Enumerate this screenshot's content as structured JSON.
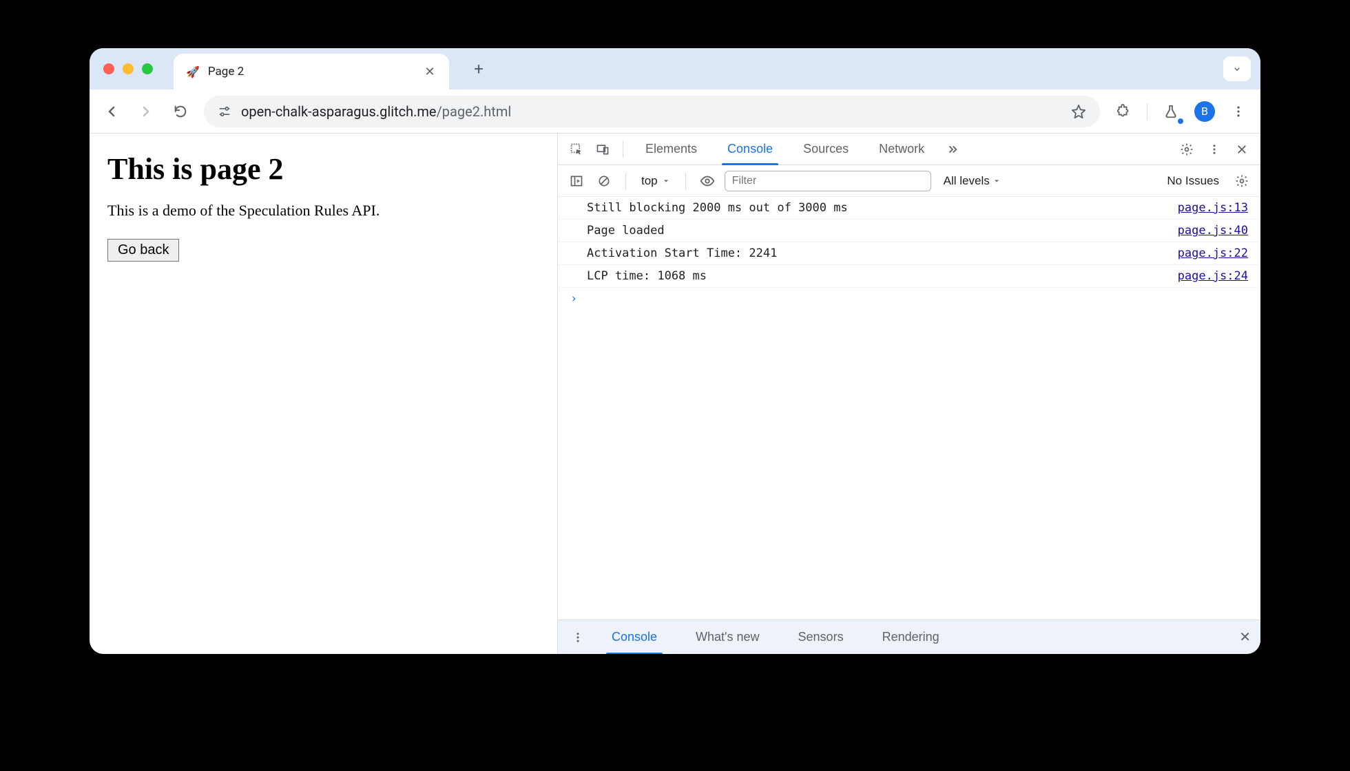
{
  "tab": {
    "title": "Page 2",
    "favicon": "rocket-icon"
  },
  "url": {
    "host": "open-chalk-asparagus.glitch.me",
    "path": "/page2.html"
  },
  "avatar": {
    "letter": "B"
  },
  "page": {
    "heading": "This is page 2",
    "paragraph": "This is a demo of the Speculation Rules API.",
    "back_button": "Go back"
  },
  "devtools": {
    "tabs": [
      "Elements",
      "Console",
      "Sources",
      "Network"
    ],
    "active_tab": "Console",
    "console_toolbar": {
      "context": "top",
      "filter_placeholder": "Filter",
      "levels": "All levels",
      "issues": "No Issues"
    },
    "logs": [
      {
        "msg": "Still blocking 2000 ms out of 3000 ms",
        "src": "page.js:13"
      },
      {
        "msg": "Page loaded",
        "src": "page.js:40"
      },
      {
        "msg": "Activation Start Time: 2241",
        "src": "page.js:22"
      },
      {
        "msg": "LCP time: 1068 ms",
        "src": "page.js:24"
      }
    ],
    "drawer_tabs": [
      "Console",
      "What's new",
      "Sensors",
      "Rendering"
    ],
    "drawer_active": "Console"
  }
}
